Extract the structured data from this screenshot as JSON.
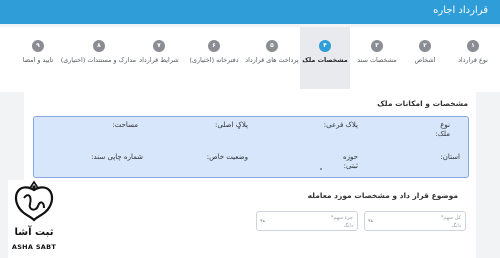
{
  "app": {
    "title": "قرارداد اجاره"
  },
  "steps": [
    {
      "number": "۱",
      "label": "نوع قرارداد"
    },
    {
      "number": "۲",
      "label": "اشخاص"
    },
    {
      "number": "۳",
      "label": "مشخصات سند"
    },
    {
      "number": "۴",
      "label": "مشخصات ملک"
    },
    {
      "number": "۵",
      "label": "پرداخت های قرارداد"
    },
    {
      "number": "۶",
      "label": "دفترخانه (اختیاری)"
    },
    {
      "number": "۷",
      "label": "شرایط قرارداد"
    },
    {
      "number": "۸",
      "label": "مدارک و مستندات (اختیاری)"
    },
    {
      "number": "۹",
      "label": "تایید و امضا"
    }
  ],
  "active_step": "۴",
  "property_section": {
    "title": "مشخصات و امکانات ملک",
    "fields": {
      "property_type": "نوع ملک:",
      "sub_plate": "پلاک فرعی:",
      "main_plate": "پلاک اصلی:",
      "area": "مساحت:",
      "province": "استان:",
      "registry_district": "حوزه ثبتی:",
      "special_status": "وضعیت خاص:",
      "print_number": "شماره چاپی سند:"
    }
  },
  "subject_section": {
    "title": "موضوع قرار داد و مشخصات مورد معامله",
    "total_share": {
      "label": "کل سهم*",
      "unit": "دانگ"
    },
    "partial_share": {
      "label": "جزء سهم*",
      "unit": "دانگ"
    }
  },
  "logo": {
    "name_fa": "ثبت آشا",
    "name_en": "ASHA SABT"
  }
}
